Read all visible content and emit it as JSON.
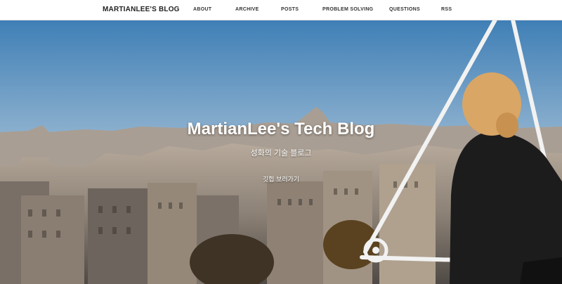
{
  "nav": {
    "brand": "MARTIANLEE'S BLOG",
    "links": [
      {
        "label": "ABOUT"
      },
      {
        "label": "ARCHIVE"
      },
      {
        "label": "POSTS"
      },
      {
        "label": "PROBLEM SOLVING"
      },
      {
        "label": "QUESTIONS"
      },
      {
        "label": "RSS"
      }
    ]
  },
  "hero": {
    "title": "MartianLee's Tech Blog",
    "subtitle": "성화의 기술 블로그",
    "link_label": "깃헙 보러가기"
  }
}
